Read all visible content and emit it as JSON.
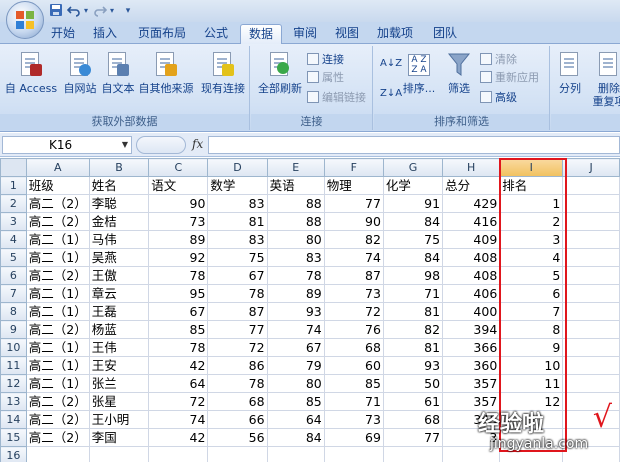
{
  "quick_access": {
    "save_icon": "save-icon",
    "undo_icon": "undo-icon",
    "redo_icon": "redo-icon",
    "customize_icon": "customize-icon"
  },
  "tabs": [
    {
      "label": "开始"
    },
    {
      "label": "插入"
    },
    {
      "label": "页面布局"
    },
    {
      "label": "公式"
    },
    {
      "label": "数据"
    },
    {
      "label": "审阅"
    },
    {
      "label": "视图"
    },
    {
      "label": "加载项"
    },
    {
      "label": "团队"
    }
  ],
  "active_tab": "数据",
  "ribbon": {
    "groups": {
      "external": {
        "label": "获取外部数据",
        "buttons": [
          "自 Access",
          "自网站",
          "自文本",
          "自其他来源",
          "现有连接"
        ]
      },
      "connections": {
        "label": "连接",
        "refresh": "全部刷新",
        "connections": "连接",
        "properties": "属性",
        "edit_links": "编辑链接"
      },
      "sort_filter": {
        "label": "排序和筛选",
        "sort": "排序...",
        "filter": "筛选",
        "clear": "清除",
        "reapply": "重新应用",
        "advanced": "高级"
      },
      "data_tools": {
        "split": "分列",
        "remove_dup_1": "删除",
        "remove_dup_2": "重复项"
      }
    }
  },
  "formula_bar": {
    "name_box": "K16",
    "fx": "fx",
    "value": ""
  },
  "columns": [
    "A",
    "B",
    "C",
    "D",
    "E",
    "F",
    "G",
    "H",
    "I",
    "J"
  ],
  "selected_column": "I",
  "rows": [
    [
      "班级",
      "姓名",
      "语文",
      "数学",
      "英语",
      "物理",
      "化学",
      "总分",
      "排名",
      ""
    ],
    [
      "高二（2）",
      "李聪",
      "90",
      "83",
      "88",
      "77",
      "91",
      "429",
      "1",
      ""
    ],
    [
      "高二（2）",
      "金桔",
      "73",
      "81",
      "88",
      "90",
      "84",
      "416",
      "2",
      ""
    ],
    [
      "高二（1）",
      "马伟",
      "89",
      "83",
      "80",
      "82",
      "75",
      "409",
      "3",
      ""
    ],
    [
      "高二（1）",
      "吴燕",
      "92",
      "75",
      "83",
      "74",
      "84",
      "408",
      "4",
      ""
    ],
    [
      "高二（2）",
      "王傲",
      "78",
      "67",
      "78",
      "87",
      "98",
      "408",
      "5",
      ""
    ],
    [
      "高二（1）",
      "章云",
      "95",
      "78",
      "89",
      "73",
      "71",
      "406",
      "6",
      ""
    ],
    [
      "高二（1）",
      "王磊",
      "67",
      "87",
      "93",
      "72",
      "81",
      "400",
      "7",
      ""
    ],
    [
      "高二（2）",
      "杨蓝",
      "85",
      "77",
      "74",
      "76",
      "82",
      "394",
      "8",
      ""
    ],
    [
      "高二（1）",
      "王伟",
      "78",
      "72",
      "67",
      "68",
      "81",
      "366",
      "9",
      ""
    ],
    [
      "高二（1）",
      "王安",
      "42",
      "86",
      "79",
      "60",
      "93",
      "360",
      "10",
      ""
    ],
    [
      "高二（1）",
      "张兰",
      "64",
      "78",
      "80",
      "85",
      "50",
      "357",
      "11",
      ""
    ],
    [
      "高二（2）",
      "张星",
      "72",
      "68",
      "85",
      "71",
      "61",
      "357",
      "12",
      ""
    ],
    [
      "高二（2）",
      "王小明",
      "74",
      "66",
      "64",
      "73",
      "68",
      "345",
      "",
      ""
    ],
    [
      "高二（2）",
      "李国",
      "42",
      "56",
      "84",
      "69",
      "77",
      "3",
      "",
      ""
    ],
    [
      "",
      "",
      "",
      "",
      "",
      "",
      "",
      "",
      "",
      ""
    ]
  ],
  "watermark": {
    "line1": "经验啦",
    "check": "√",
    "line2": "jingyanla.com"
  },
  "colors": {
    "highlight_box": "#e0161d",
    "ribbon_text": "#15428b"
  }
}
